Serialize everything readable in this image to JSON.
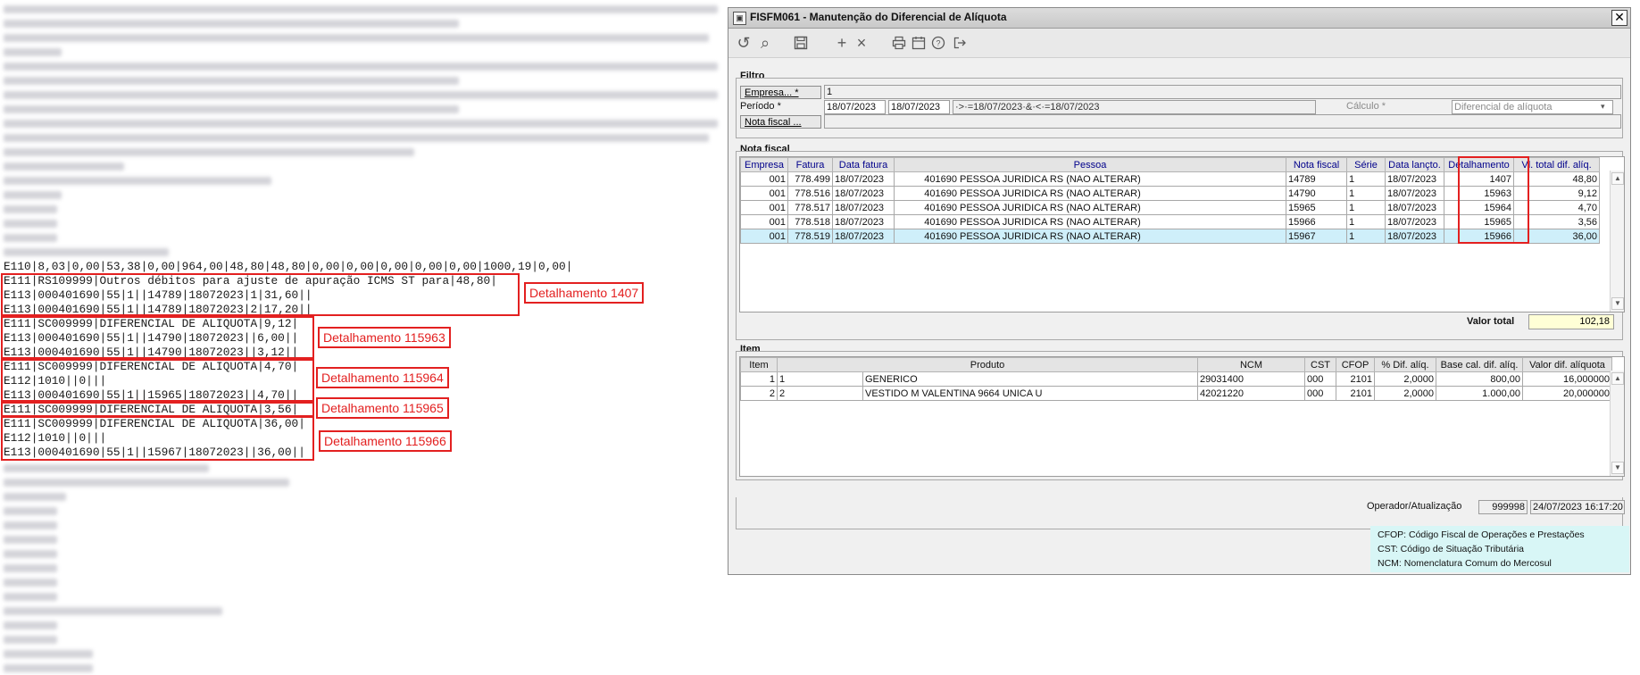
{
  "text_file": {
    "lines": [
      "E110|8,03|0,00|53,38|0,00|964,00|48,80|48,80|0,00|0,00|0,00|0,00|0,00|1000,19|0,00|",
      "E111|RS109999|Outros débitos para ajuste de apuração ICMS ST para|48,80|",
      "E113|000401690|55|1||14789|18072023|1|31,60||",
      "E113|000401690|55|1||14789|18072023|2|17,20||",
      "E111|SC009999|DIFERENCIAL DE ALIQUOTA|9,12|",
      "E113|000401690|55|1||14790|18072023||6,00||",
      "E113|000401690|55|1||14790|18072023||3,12||",
      "E111|SC009999|DIFERENCIAL DE ALIQUOTA|4,70|",
      "E112|1010||0|||",
      "E113|000401690|55|1||15965|18072023||4,70||",
      "E111|SC009999|DIFERENCIAL DE ALIQUOTA|3,56|",
      "E111|SC009999|DIFERENCIAL DE ALIQUOTA|36,00|",
      "E112|1010||0|||",
      "E113|000401690|55|1||15967|18072023||36,00||"
    ],
    "callouts": [
      "Detalhamento 1407",
      "Detalhamento 115963",
      "Detalhamento 115964",
      "Detalhamento 115965",
      "Detalhamento 115966"
    ]
  },
  "window": {
    "title": "FISFM061 - Manutenção do Diferencial de Alíquota",
    "close": "✕"
  },
  "toolbar_icons": [
    "refresh-icon",
    "search-icon",
    "save-icon",
    "add-icon",
    "delete-icon",
    "print-icon",
    "calendar-icon",
    "help-icon",
    "exit-icon"
  ],
  "filtro": {
    "label": "Filtro",
    "empresa_btn": "Empresa... *",
    "empresa_value": "1",
    "periodo_label": "Período *",
    "periodo_de": "18/07/2023",
    "periodo_ate": "18/07/2023",
    "periodo_expr": "·>·=18/07/2023·&·<·=18/07/2023",
    "calculo_label": "Cálculo *",
    "calculo_value": "Diferencial de alíquota",
    "nota_btn": "Nota fiscal ...",
    "nota_value": ""
  },
  "nota_fiscal": {
    "label": "Nota fiscal",
    "columns": [
      "Empresa",
      "Fatura",
      "Data fatura",
      "Pessoa",
      "Nota fiscal",
      "Série",
      "Data lançto.",
      "Detalhamento",
      "Vl. total dif. alíq."
    ],
    "rows": [
      {
        "empresa": "001",
        "fatura": "778.499",
        "data_fatura": "18/07/2023",
        "pessoa_cod": "401690",
        "pessoa": "PESSOA JURIDICA RS (NAO ALTERAR)",
        "nota": "14789",
        "serie": "1",
        "data_lancto": "18/07/2023",
        "detalhamento": "1407",
        "total": "48,80"
      },
      {
        "empresa": "001",
        "fatura": "778.516",
        "data_fatura": "18/07/2023",
        "pessoa_cod": "401690",
        "pessoa": "PESSOA JURIDICA RS (NAO ALTERAR)",
        "nota": "14790",
        "serie": "1",
        "data_lancto": "18/07/2023",
        "detalhamento": "15963",
        "total": "9,12"
      },
      {
        "empresa": "001",
        "fatura": "778.517",
        "data_fatura": "18/07/2023",
        "pessoa_cod": "401690",
        "pessoa": "PESSOA JURIDICA RS (NAO ALTERAR)",
        "nota": "15965",
        "serie": "1",
        "data_lancto": "18/07/2023",
        "detalhamento": "15964",
        "total": "4,70"
      },
      {
        "empresa": "001",
        "fatura": "778.518",
        "data_fatura": "18/07/2023",
        "pessoa_cod": "401690",
        "pessoa": "PESSOA JURIDICA RS (NAO ALTERAR)",
        "nota": "15966",
        "serie": "1",
        "data_lancto": "18/07/2023",
        "detalhamento": "15965",
        "total": "3,56"
      },
      {
        "empresa": "001",
        "fatura": "778.519",
        "data_fatura": "18/07/2023",
        "pessoa_cod": "401690",
        "pessoa": "PESSOA JURIDICA RS (NAO ALTERAR)",
        "nota": "15967",
        "serie": "1",
        "data_lancto": "18/07/2023",
        "detalhamento": "15966",
        "total": "36,00"
      }
    ],
    "selected_row": 4,
    "valor_total_label": "Valor total",
    "valor_total": "102,18"
  },
  "item": {
    "label": "Item",
    "columns": [
      "Item",
      "Produto",
      "NCM",
      "CST",
      "CFOP",
      "% Dif. alíq.",
      "Base cal. dif. alíq.",
      "Valor dif. alíquota"
    ],
    "rows": [
      {
        "item": "1",
        "produto_cod": "1",
        "produto": "GENERICO",
        "ncm": "29031400",
        "cst": "000",
        "cfop": "2101",
        "pct": "2,0000",
        "base": "800,00",
        "valor": "16,000000"
      },
      {
        "item": "2",
        "produto_cod": "2",
        "produto": "VESTIDO M VALENTINA 9664 UNICA U",
        "ncm": "42021220",
        "cst": "000",
        "cfop": "2101",
        "pct": "2,0000",
        "base": "1.000,00",
        "valor": "20,000000"
      }
    ]
  },
  "footer": {
    "operador_label": "Operador/Atualização",
    "operador": "999998",
    "atualizacao": "24/07/2023 16:17:20"
  },
  "legend": [
    "CFOP: Código Fiscal de Operações e Prestações",
    "CST: Código de Situação Tributária",
    "NCM: Nomenclatura Comum do Mercosul"
  ],
  "colors": {
    "highlight": "#e32020",
    "selected_row": "#cfeffa",
    "legend_bg": "#d8f6f6",
    "total_bg": "#ffffd6"
  }
}
